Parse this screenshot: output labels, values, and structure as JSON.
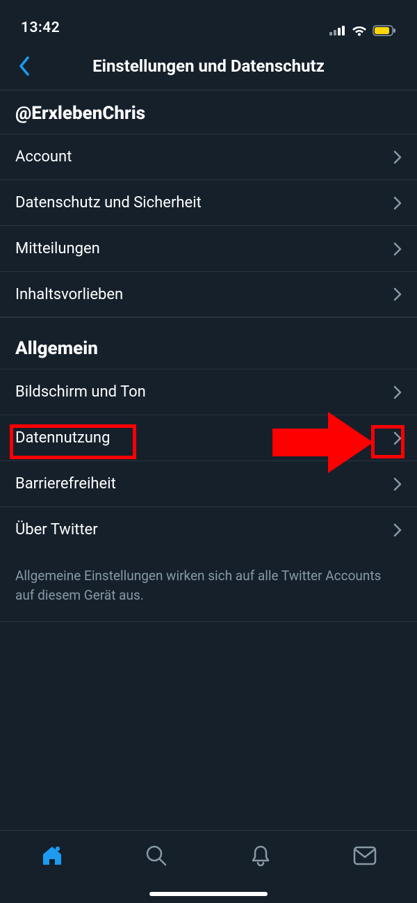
{
  "status": {
    "time": "13:42"
  },
  "header": {
    "title": "Einstellungen und Datenschutz"
  },
  "account_handle": "@ErxlebenChris",
  "group1": {
    "items": [
      {
        "label": "Account"
      },
      {
        "label": "Datenschutz und Sicherheit"
      },
      {
        "label": "Mitteilungen"
      },
      {
        "label": "Inhaltsvorlieben"
      }
    ]
  },
  "group2": {
    "title": "Allgemein",
    "items": [
      {
        "label": "Bildschirm und Ton"
      },
      {
        "label": "Datennutzung"
      },
      {
        "label": "Barrierefreiheit"
      },
      {
        "label": "Über Twitter"
      }
    ],
    "footer": "Allgemeine Einstellungen wirken sich auf alle Twitter Accounts auf diesem Gerät aus."
  },
  "colors": {
    "accent": "#1d9bf0",
    "battery": "#ffd60a",
    "chevron": "#8899a6",
    "highlight": "#ff0000"
  }
}
